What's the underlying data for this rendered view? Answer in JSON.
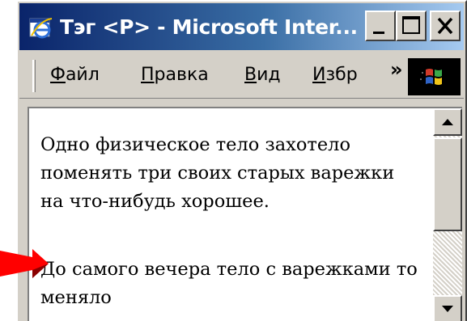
{
  "window": {
    "title": "Тэг <P> - Microsoft Inter...",
    "icons": {
      "app": "ie-icon",
      "minimize": "minimize-icon",
      "maximize": "maximize-icon",
      "close": "close-icon"
    }
  },
  "menu": {
    "items": [
      {
        "underline": "Ф",
        "rest": "айл"
      },
      {
        "underline": "П",
        "rest": "равка"
      },
      {
        "underline": "В",
        "rest": "ид"
      },
      {
        "underline": "И",
        "rest": "збр"
      }
    ],
    "overflow_label": "»"
  },
  "content": {
    "paragraph1": "Одно физическое тело захотело поменять три своих старых варежки на что-нибудь хорошее.",
    "paragraph2": "До самого вечера тело с варежками то меняло"
  },
  "colors": {
    "title_bar_start": "#0a246a",
    "title_bar_end": "#a6caf0",
    "window_face": "#d4d0c8",
    "pointer_arrow": "#ff0000"
  }
}
